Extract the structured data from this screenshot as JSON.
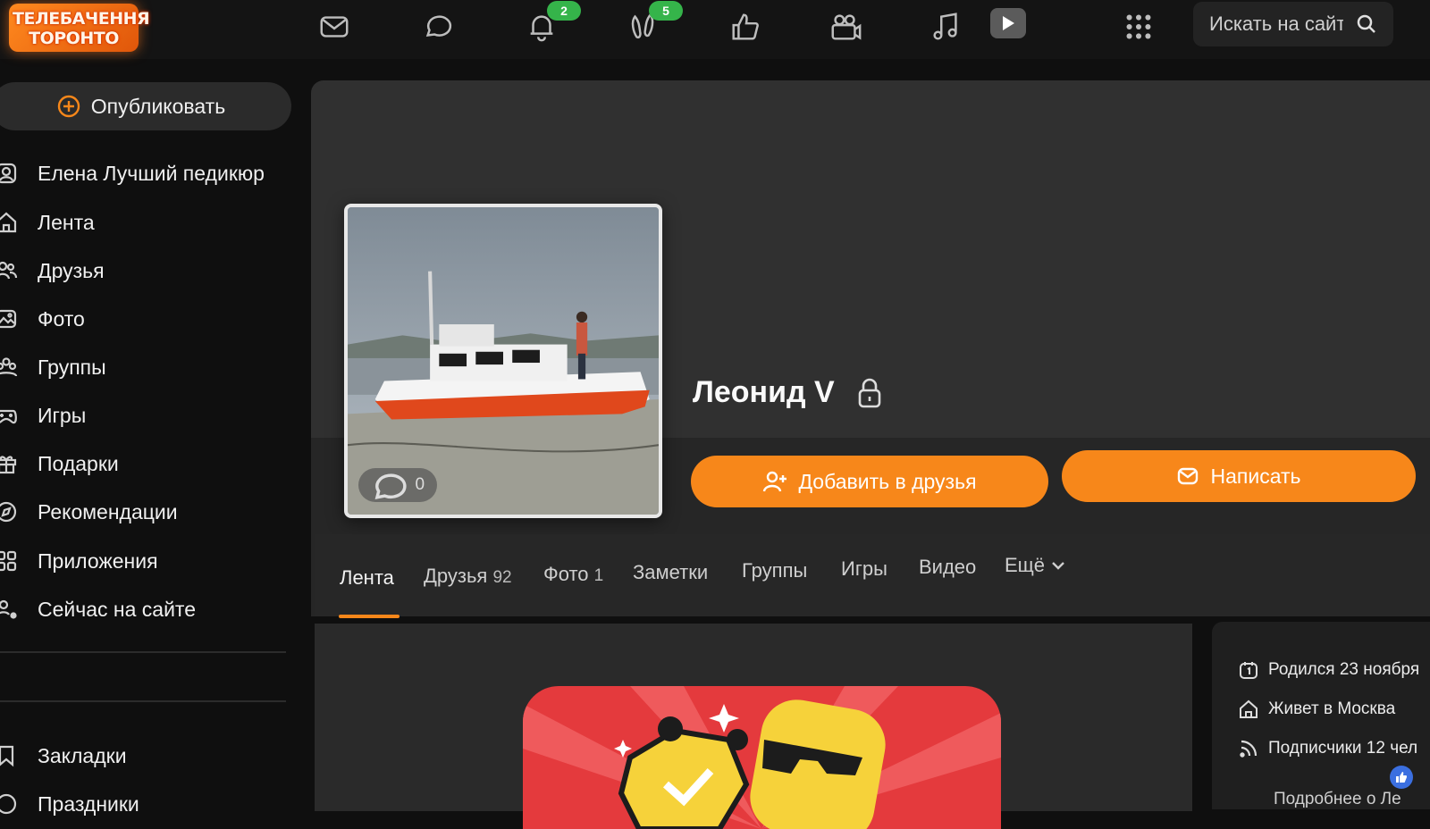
{
  "logo": {
    "line1": "ТЕЛЕБАЧЕННЯ",
    "line2": "ТОРОНТО"
  },
  "topnav": {
    "icons": [
      "mail-icon",
      "chat-icon",
      "bell-icon",
      "guests-icon",
      "like-icon",
      "camera-icon",
      "music-icon",
      "video-icon",
      "apps-grid-icon"
    ],
    "notifications_badge": "2",
    "guests_badge": "5"
  },
  "search": {
    "placeholder": "Искать на сайте"
  },
  "sidebar": {
    "publish_label": "Опубликовать",
    "items": [
      {
        "label": "Елена Лучший педикюр",
        "icon": "user-icon"
      },
      {
        "label": "Лента",
        "icon": "home-icon"
      },
      {
        "label": "Друзья",
        "icon": "friends-icon"
      },
      {
        "label": "Фото",
        "icon": "photo-icon"
      },
      {
        "label": "Группы",
        "icon": "groups-icon"
      },
      {
        "label": "Игры",
        "icon": "gamepad-icon"
      },
      {
        "label": "Подарки",
        "icon": "gift-icon"
      },
      {
        "label": "Рекомендации",
        "icon": "compass-icon"
      },
      {
        "label": "Приложения",
        "icon": "apps-icon"
      },
      {
        "label": "Сейчас на сайте",
        "icon": "online-icon"
      }
    ],
    "bottom_items": [
      {
        "label": "Закладки",
        "icon": "bookmark-icon"
      },
      {
        "label": "Праздники",
        "icon": "holiday-icon"
      }
    ]
  },
  "profile": {
    "name": "Леонид V",
    "photo_comments": "0",
    "add_friend_label": "Добавить в друзья",
    "write_label": "Написать"
  },
  "tabs": [
    {
      "label": "Лента",
      "count": ""
    },
    {
      "label": "Друзья",
      "count": "92"
    },
    {
      "label": "Фото",
      "count": "1"
    },
    {
      "label": "Заметки",
      "count": ""
    },
    {
      "label": "Группы",
      "count": ""
    },
    {
      "label": "Игры",
      "count": ""
    },
    {
      "label": "Видео",
      "count": ""
    },
    {
      "label": "Ещё",
      "count": ""
    }
  ],
  "info": {
    "birthday": "Родился 23 ноября",
    "lives": "Живет в Москва",
    "subscribers": "Подписчики 12 чел",
    "more": "Подробнее о Ле"
  },
  "colors": {
    "accent": "#f7871a",
    "badge": "#35b44a",
    "background": "#0f0f0f"
  }
}
